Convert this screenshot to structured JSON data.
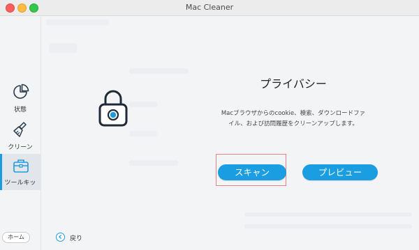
{
  "window": {
    "title": "Mac Cleaner"
  },
  "sidebar": {
    "items": [
      {
        "label": "状態",
        "icon": "pie-chart-icon"
      },
      {
        "label": "クリーン",
        "icon": "broom-icon"
      },
      {
        "label": "ツールキッ",
        "icon": "toolbox-icon",
        "active": true
      }
    ],
    "home_label": "ホーム"
  },
  "privacy": {
    "title": "プライバシー",
    "description_line1": "Macブラウザからのcookie、検索、ダウンロードファ",
    "description_line2": "イル、および訪問履歴をクリーンアップします。"
  },
  "actions": {
    "scan_label": "スキャン",
    "preview_label": "プレビュー"
  },
  "footer": {
    "back_label": "戻り"
  },
  "colors": {
    "accent": "#1a9de1",
    "highlight_frame": "#e88086"
  }
}
